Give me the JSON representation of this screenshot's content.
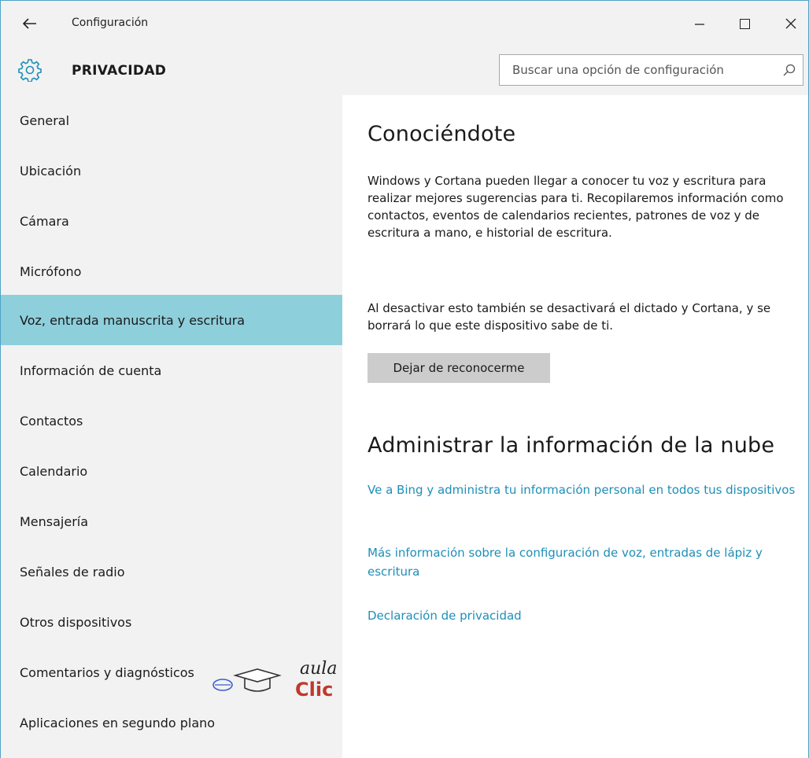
{
  "window": {
    "title": "Configuración",
    "back_icon": "back-arrow-icon",
    "minimize_glyph": "—",
    "close_glyph": "✕"
  },
  "header": {
    "page_title": "PRIVACIDAD",
    "icon": "gear-icon",
    "search": {
      "placeholder": "Buscar una opción de configuración",
      "value": ""
    }
  },
  "sidebar": {
    "items": [
      {
        "label": "General",
        "active": false
      },
      {
        "label": "Ubicación",
        "active": false
      },
      {
        "label": "Cámara",
        "active": false
      },
      {
        "label": "Micrófono",
        "active": false
      },
      {
        "label": "Voz, entrada manuscrita y escritura",
        "active": true
      },
      {
        "label": "Información de cuenta",
        "active": false
      },
      {
        "label": "Contactos",
        "active": false
      },
      {
        "label": "Calendario",
        "active": false
      },
      {
        "label": "Mensajería",
        "active": false
      },
      {
        "label": "Señales de radio",
        "active": false
      },
      {
        "label": "Otros dispositivos",
        "active": false
      },
      {
        "label": "Comentarios y diagnósticos",
        "active": false
      },
      {
        "label": "Aplicaciones en segundo plano",
        "active": false
      }
    ]
  },
  "main": {
    "section1": {
      "title": "Conociéndote",
      "paragraph1": "Windows y Cortana pueden llegar a conocer tu voz y escritura para realizar mejores sugerencias para ti. Recopilaremos información como contactos, eventos de calendarios recientes, patrones de voz y de escritura a mano, e historial de escritura.",
      "paragraph2": "Al desactivar esto también se desactivará el dictado y Cortana, y se borrará lo que este dispositivo sabe de ti.",
      "button_label": "Dejar de reconocerme"
    },
    "section2": {
      "title": "Administrar la información de la nube",
      "links": [
        "Ve a Bing y administra tu información personal en todos tus dispositivos",
        "Más información sobre la configuración de voz, entradas de lápiz y escritura",
        "Declaración de privacidad"
      ]
    }
  },
  "watermark": {
    "line1": "aula",
    "line2": "Clic"
  },
  "colors": {
    "accent": "#8ecfdc",
    "link": "#1e8fb8",
    "sidebar_bg": "#f2f2f2",
    "button_bg": "#cccccc",
    "watermark_red": "#c0392b",
    "watermark_blue": "#3a5fcd"
  }
}
